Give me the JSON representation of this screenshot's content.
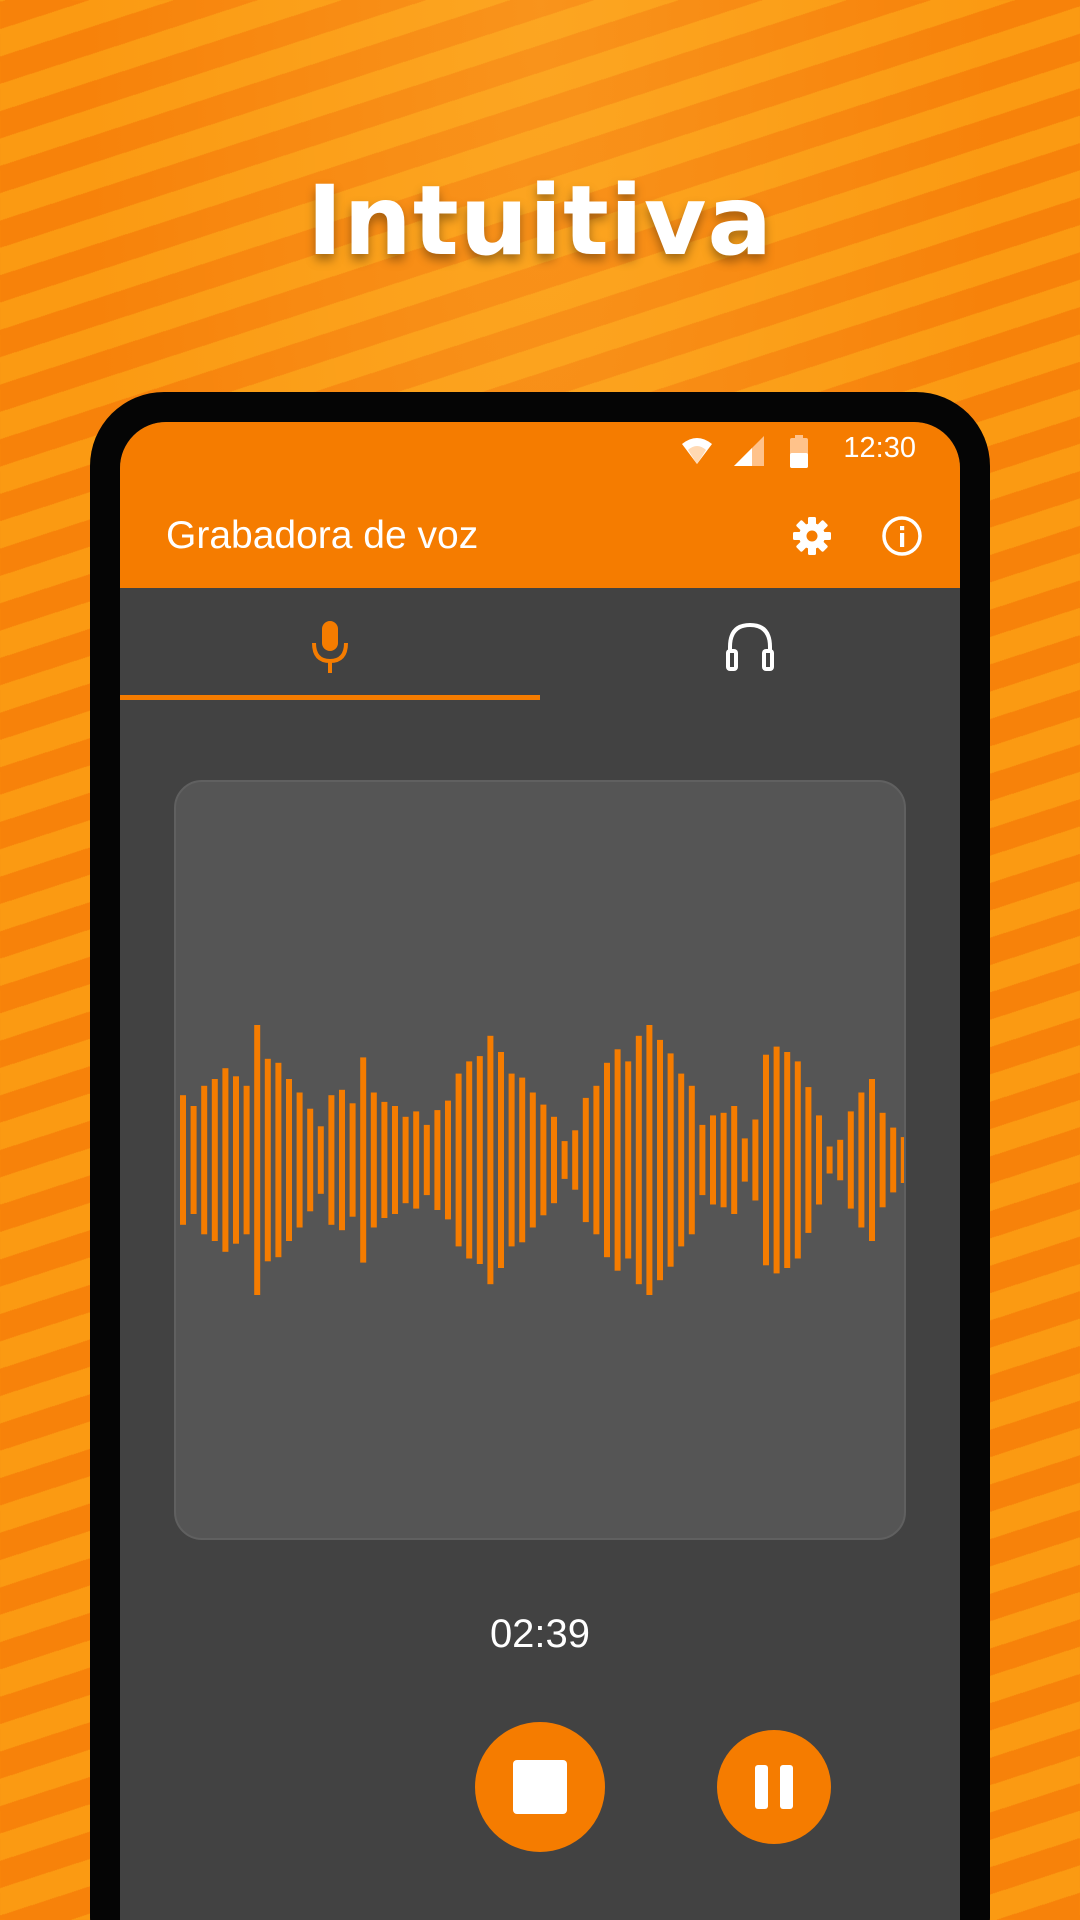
{
  "headline": "Intuitiva",
  "status_bar": {
    "time": "12:30",
    "icons": [
      "wifi-icon",
      "signal-icon",
      "battery-icon"
    ]
  },
  "app_bar": {
    "title": "Grabadora de voz",
    "actions": [
      "settings-gear-icon",
      "info-icon"
    ]
  },
  "tabs": [
    {
      "id": "record",
      "icon": "microphone-icon",
      "selected": true
    },
    {
      "id": "player",
      "icon": "headphones-icon",
      "selected": false
    }
  ],
  "recorder": {
    "elapsed": "02:39",
    "state": "recording",
    "controls": [
      "stop-icon",
      "pause-icon"
    ],
    "waveform_levels": [
      0.48,
      0.4,
      0.55,
      0.6,
      0.68,
      0.62,
      0.55,
      1.0,
      0.75,
      0.72,
      0.6,
      0.5,
      0.38,
      0.25,
      0.48,
      0.52,
      0.42,
      0.76,
      0.5,
      0.43,
      0.4,
      0.32,
      0.36,
      0.26,
      0.37,
      0.44,
      0.64,
      0.73,
      0.77,
      0.92,
      0.8,
      0.64,
      0.61,
      0.5,
      0.41,
      0.32,
      0.14,
      0.22,
      0.46,
      0.55,
      0.72,
      0.82,
      0.73,
      0.92,
      1.0,
      0.89,
      0.79,
      0.64,
      0.55,
      0.26,
      0.33,
      0.35,
      0.4,
      0.16,
      0.3,
      0.78,
      0.84,
      0.8,
      0.73,
      0.54,
      0.33,
      0.1,
      0.15,
      0.36,
      0.5,
      0.6,
      0.35,
      0.24,
      0.17,
      0.09,
      0.38,
      0.49,
      0.28,
      0.39
    ],
    "colors": {
      "accent": "#f57c00",
      "panel": "#555555",
      "background": "#424242"
    }
  }
}
